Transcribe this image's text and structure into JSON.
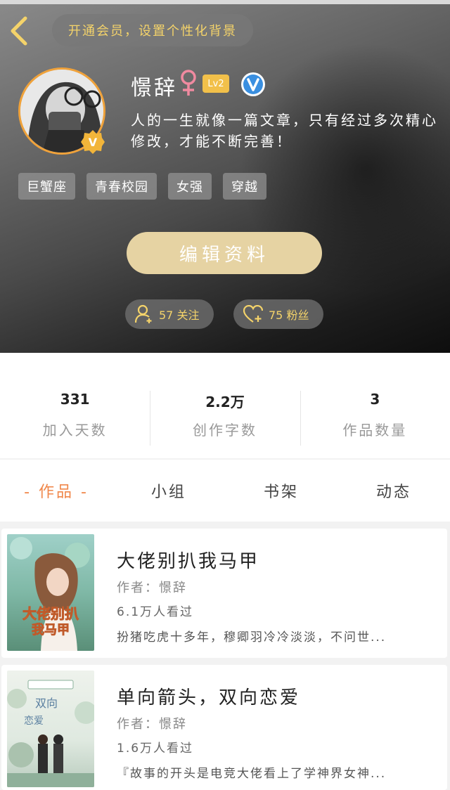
{
  "header": {
    "vip_banner": "开通会员，设置个性化背景",
    "username": "憬辞",
    "gender_symbol": "♀",
    "level": "Lv2",
    "bio": "人的一生就像一篇文章，只有经过多次精心修改，才能不断完善！",
    "tags": [
      "巨蟹座",
      "青春校园",
      "女强",
      "穿越"
    ],
    "edit_button": "编辑资料",
    "follow_label": "57 关注",
    "fans_label": "75 粉丝",
    "accent_color": "#f4d36a",
    "avatar_border_color": "#f0a23a"
  },
  "stats": [
    {
      "value": "331",
      "label": "加入天数"
    },
    {
      "value": "2.2万",
      "label": "创作字数"
    },
    {
      "value": "3",
      "label": "作品数量"
    }
  ],
  "tabs": [
    {
      "label": "- 作品 -",
      "active": true
    },
    {
      "label": "小组",
      "active": false
    },
    {
      "label": "书架",
      "active": false
    },
    {
      "label": "动态",
      "active": false
    }
  ],
  "works": [
    {
      "title": "大佬别扒我马甲",
      "author": "作者：憬辞",
      "views": "6.1万人看过",
      "description": "扮猪吃虎十多年，穆卿羽冷冷淡淡，不问世..."
    },
    {
      "title": "单向箭头，双向恋爱",
      "author": "作者：憬辞",
      "views": "1.6万人看过",
      "description": "『故事的开头是电竞大佬看上了学神界女神..."
    }
  ],
  "colors": {
    "tab_active": "#f0874a",
    "edit_button_bg": "#e6d3a3",
    "level_badge_bg": "#f2c04a",
    "verified_blue": "#3a8fe0",
    "gender_pink": "#f08aa0"
  }
}
